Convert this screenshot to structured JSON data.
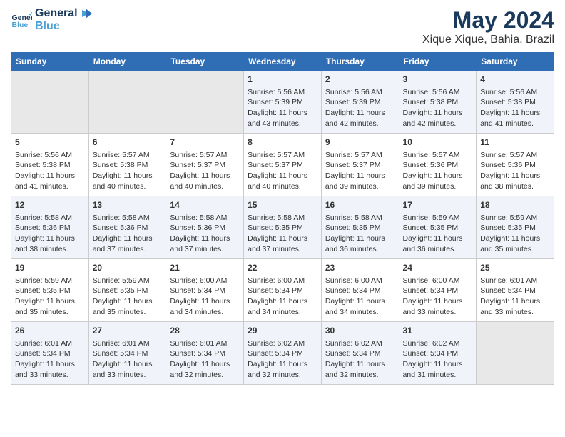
{
  "logo": {
    "line1": "General",
    "line2": "Blue"
  },
  "title": "May 2024",
  "subtitle": "Xique Xique, Bahia, Brazil",
  "days_header": [
    "Sunday",
    "Monday",
    "Tuesday",
    "Wednesday",
    "Thursday",
    "Friday",
    "Saturday"
  ],
  "weeks": [
    [
      {
        "day": "",
        "info": ""
      },
      {
        "day": "",
        "info": ""
      },
      {
        "day": "",
        "info": ""
      },
      {
        "day": "1",
        "info": "Sunrise: 5:56 AM\nSunset: 5:39 PM\nDaylight: 11 hours\nand 43 minutes."
      },
      {
        "day": "2",
        "info": "Sunrise: 5:56 AM\nSunset: 5:39 PM\nDaylight: 11 hours\nand 42 minutes."
      },
      {
        "day": "3",
        "info": "Sunrise: 5:56 AM\nSunset: 5:38 PM\nDaylight: 11 hours\nand 42 minutes."
      },
      {
        "day": "4",
        "info": "Sunrise: 5:56 AM\nSunset: 5:38 PM\nDaylight: 11 hours\nand 41 minutes."
      }
    ],
    [
      {
        "day": "5",
        "info": "Sunrise: 5:56 AM\nSunset: 5:38 PM\nDaylight: 11 hours\nand 41 minutes."
      },
      {
        "day": "6",
        "info": "Sunrise: 5:57 AM\nSunset: 5:38 PM\nDaylight: 11 hours\nand 40 minutes."
      },
      {
        "day": "7",
        "info": "Sunrise: 5:57 AM\nSunset: 5:37 PM\nDaylight: 11 hours\nand 40 minutes."
      },
      {
        "day": "8",
        "info": "Sunrise: 5:57 AM\nSunset: 5:37 PM\nDaylight: 11 hours\nand 40 minutes."
      },
      {
        "day": "9",
        "info": "Sunrise: 5:57 AM\nSunset: 5:37 PM\nDaylight: 11 hours\nand 39 minutes."
      },
      {
        "day": "10",
        "info": "Sunrise: 5:57 AM\nSunset: 5:36 PM\nDaylight: 11 hours\nand 39 minutes."
      },
      {
        "day": "11",
        "info": "Sunrise: 5:57 AM\nSunset: 5:36 PM\nDaylight: 11 hours\nand 38 minutes."
      }
    ],
    [
      {
        "day": "12",
        "info": "Sunrise: 5:58 AM\nSunset: 5:36 PM\nDaylight: 11 hours\nand 38 minutes."
      },
      {
        "day": "13",
        "info": "Sunrise: 5:58 AM\nSunset: 5:36 PM\nDaylight: 11 hours\nand 37 minutes."
      },
      {
        "day": "14",
        "info": "Sunrise: 5:58 AM\nSunset: 5:36 PM\nDaylight: 11 hours\nand 37 minutes."
      },
      {
        "day": "15",
        "info": "Sunrise: 5:58 AM\nSunset: 5:35 PM\nDaylight: 11 hours\nand 37 minutes."
      },
      {
        "day": "16",
        "info": "Sunrise: 5:58 AM\nSunset: 5:35 PM\nDaylight: 11 hours\nand 36 minutes."
      },
      {
        "day": "17",
        "info": "Sunrise: 5:59 AM\nSunset: 5:35 PM\nDaylight: 11 hours\nand 36 minutes."
      },
      {
        "day": "18",
        "info": "Sunrise: 5:59 AM\nSunset: 5:35 PM\nDaylight: 11 hours\nand 35 minutes."
      }
    ],
    [
      {
        "day": "19",
        "info": "Sunrise: 5:59 AM\nSunset: 5:35 PM\nDaylight: 11 hours\nand 35 minutes."
      },
      {
        "day": "20",
        "info": "Sunrise: 5:59 AM\nSunset: 5:35 PM\nDaylight: 11 hours\nand 35 minutes."
      },
      {
        "day": "21",
        "info": "Sunrise: 6:00 AM\nSunset: 5:34 PM\nDaylight: 11 hours\nand 34 minutes."
      },
      {
        "day": "22",
        "info": "Sunrise: 6:00 AM\nSunset: 5:34 PM\nDaylight: 11 hours\nand 34 minutes."
      },
      {
        "day": "23",
        "info": "Sunrise: 6:00 AM\nSunset: 5:34 PM\nDaylight: 11 hours\nand 34 minutes."
      },
      {
        "day": "24",
        "info": "Sunrise: 6:00 AM\nSunset: 5:34 PM\nDaylight: 11 hours\nand 33 minutes."
      },
      {
        "day": "25",
        "info": "Sunrise: 6:01 AM\nSunset: 5:34 PM\nDaylight: 11 hours\nand 33 minutes."
      }
    ],
    [
      {
        "day": "26",
        "info": "Sunrise: 6:01 AM\nSunset: 5:34 PM\nDaylight: 11 hours\nand 33 minutes."
      },
      {
        "day": "27",
        "info": "Sunrise: 6:01 AM\nSunset: 5:34 PM\nDaylight: 11 hours\nand 33 minutes."
      },
      {
        "day": "28",
        "info": "Sunrise: 6:01 AM\nSunset: 5:34 PM\nDaylight: 11 hours\nand 32 minutes."
      },
      {
        "day": "29",
        "info": "Sunrise: 6:02 AM\nSunset: 5:34 PM\nDaylight: 11 hours\nand 32 minutes."
      },
      {
        "day": "30",
        "info": "Sunrise: 6:02 AM\nSunset: 5:34 PM\nDaylight: 11 hours\nand 32 minutes."
      },
      {
        "day": "31",
        "info": "Sunrise: 6:02 AM\nSunset: 5:34 PM\nDaylight: 11 hours\nand 31 minutes."
      },
      {
        "day": "",
        "info": ""
      }
    ]
  ]
}
